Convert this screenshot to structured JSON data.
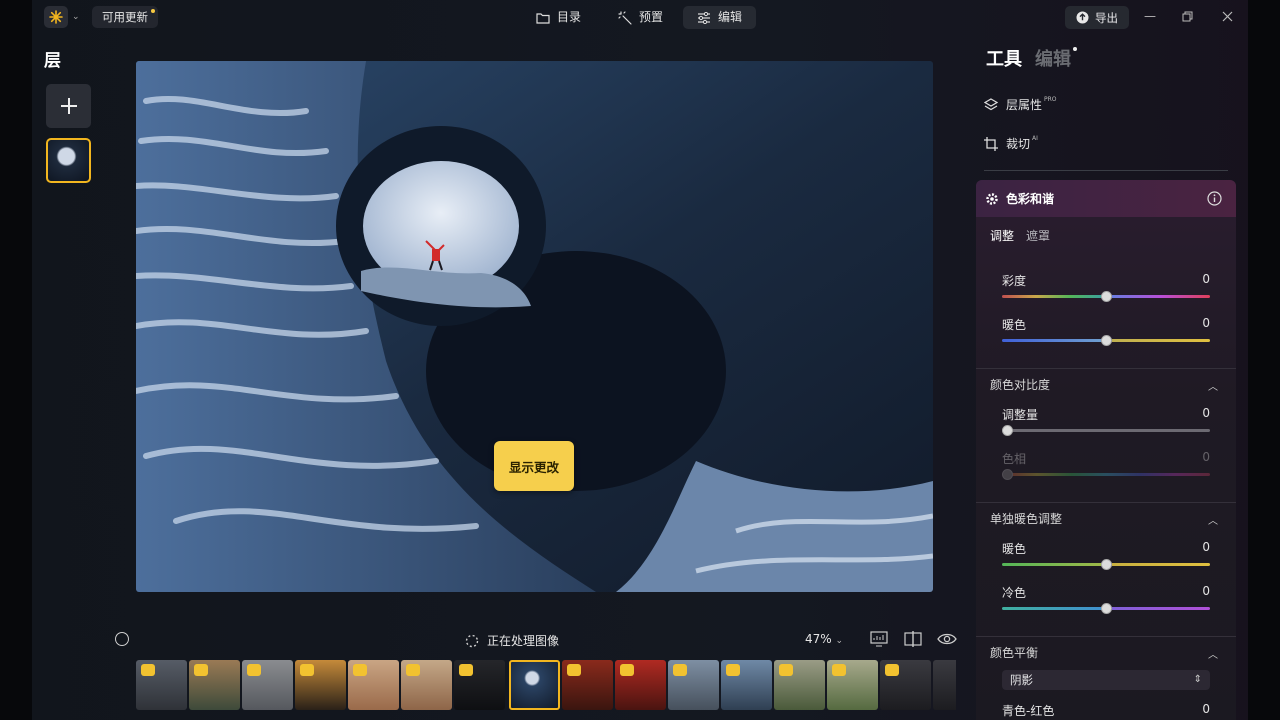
{
  "topbar": {
    "update_label": "可用更新",
    "tabs": [
      {
        "label": "目录",
        "icon": "folder-icon"
      },
      {
        "label": "预置",
        "icon": "magic-wand-icon"
      },
      {
        "label": "编辑",
        "icon": "sliders-icon"
      }
    ],
    "active_tab": "编辑",
    "export_label": "导出"
  },
  "layers": {
    "title": "层"
  },
  "canvas": {
    "show_changes_label": "显示更改"
  },
  "bottombar": {
    "processing_label": "正在处理图像",
    "zoom": "47%"
  },
  "right_panel": {
    "tab_tools": "工具",
    "tab_edit": "编辑",
    "layer_props": {
      "label": "层属性",
      "badge": "PRO"
    },
    "crop": {
      "label": "裁切",
      "badge": "AI"
    },
    "panel_title": "色彩和谐",
    "subtabs": [
      "调整",
      "遮罩"
    ],
    "sliders_main": [
      {
        "label": "彩度",
        "value": "0"
      },
      {
        "label": "暖色",
        "value": "0"
      }
    ],
    "color_contrast": {
      "title": "颜色对比度",
      "sliders": [
        {
          "label": "调整量",
          "value": "0"
        },
        {
          "label": "色相",
          "value": "0"
        }
      ]
    },
    "warmth": {
      "title": "单独暖色调整",
      "sliders": [
        {
          "label": "暖色",
          "value": "0"
        },
        {
          "label": "冷色",
          "value": "0"
        }
      ]
    },
    "color_balance": {
      "title": "颜色平衡",
      "select_value": "阴影",
      "slider": {
        "label": "青色-红色",
        "value": "0"
      }
    }
  },
  "colors": {
    "accent": "#f2b61f",
    "button": "#f6cf4c"
  }
}
